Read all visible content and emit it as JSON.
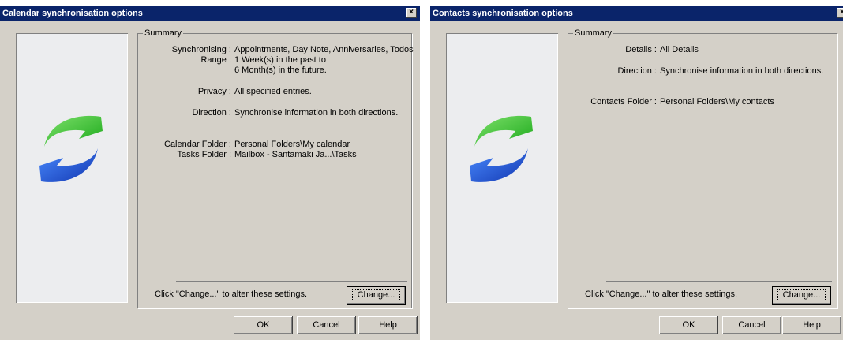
{
  "calendar_dialog": {
    "title": "Calendar synchronisation options",
    "close_glyph": "×",
    "summary": {
      "group_title": "Summary",
      "rows": [
        {
          "label": "Synchronising :",
          "value": "Appointments, Day Note, Anniversaries, Todos"
        },
        {
          "label": "Range :",
          "value": "1 Week(s) in the past to"
        },
        {
          "label": "",
          "value": "6 Month(s) in the future."
        },
        {
          "label": "Privacy :",
          "value": "All specified entries."
        },
        {
          "label": "Direction :",
          "value": "Synchronise information in both directions."
        },
        {
          "label": "Calendar Folder :",
          "value": "Personal Folders\\My calendar"
        },
        {
          "label": "Tasks Folder :",
          "value": "Mailbox - Santamaki Ja...\\Tasks"
        }
      ],
      "hint": "Click \"Change...\" to alter these settings.",
      "change_button": "Change..."
    },
    "buttons": {
      "ok": "OK",
      "cancel": "Cancel",
      "help": "Help"
    }
  },
  "contacts_dialog": {
    "title": "Contacts synchronisation options",
    "close_glyph": "×",
    "summary": {
      "group_title": "Summary",
      "rows": [
        {
          "label": "Details :",
          "value": "All Details"
        },
        {
          "label": "Direction :",
          "value": "Synchronise information in both directions."
        },
        {
          "label": "Contacts Folder :",
          "value": "Personal Folders\\My contacts"
        }
      ],
      "hint": "Click \"Change...\" to alter these settings.",
      "change_button": "Change..."
    },
    "buttons": {
      "ok": "OK",
      "cancel": "Cancel",
      "help": "Help"
    }
  },
  "colors": {
    "titlebar": "#0a246a",
    "dialog_face": "#d4d0c8",
    "logo_green": "#2fbf2f",
    "logo_blue": "#2255cc"
  },
  "icons": {
    "logo": "sync-arrows-icon",
    "close": "close-icon"
  }
}
